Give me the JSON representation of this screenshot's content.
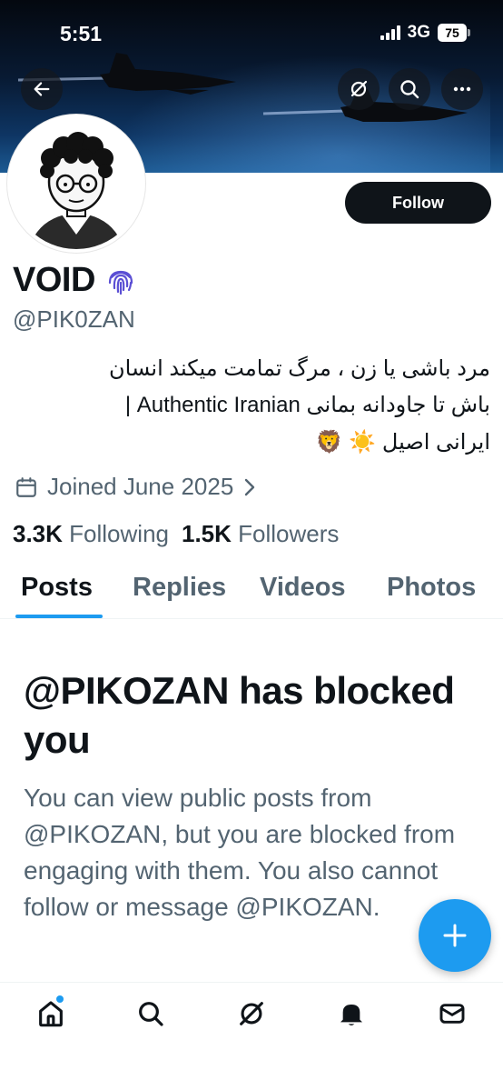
{
  "status_bar": {
    "time": "5:51",
    "network": "3G",
    "battery": "75"
  },
  "profile": {
    "name": "VOID",
    "handle": "@PIK0ZAN",
    "bio_lines": [
      "مرد باشی یا زن ، مرگ تمامت میکند انسان",
      "باش تا جاودانه بمانی Authentic Iranian |",
      "ایرانی اصیل ☀️ 🦁"
    ],
    "joined": "Joined June 2025",
    "following_count": "3.3K",
    "following_label": "Following",
    "followers_count": "1.5K",
    "followers_label": "Followers"
  },
  "actions": {
    "follow_label": "Follow"
  },
  "tabs": [
    {
      "label": "Posts",
      "active": true
    },
    {
      "label": "Replies",
      "active": false
    },
    {
      "label": "Videos",
      "active": false
    },
    {
      "label": "Photos",
      "active": false
    }
  ],
  "blocked": {
    "title": "@PIKOZAN has blocked you",
    "description": "You can view public posts from @PIKOZAN, but you are blocked from engaging with them. You also cannot follow or message @PIKOZAN."
  },
  "icons": {
    "back": "back-arrow-icon",
    "grok": "grok-icon",
    "search": "search-icon",
    "more": "more-icon",
    "verified": "fingerprint-icon",
    "calendar": "calendar-icon",
    "chevron": "chevron-right-icon",
    "compose": "plus-icon",
    "nav": [
      "home-icon",
      "search-icon",
      "grok-icon",
      "bell-icon",
      "mail-icon"
    ]
  },
  "colors": {
    "accent": "#1d9bf0",
    "text": "#0f1419",
    "secondary": "#536471",
    "verified": "#5b4fd4"
  }
}
